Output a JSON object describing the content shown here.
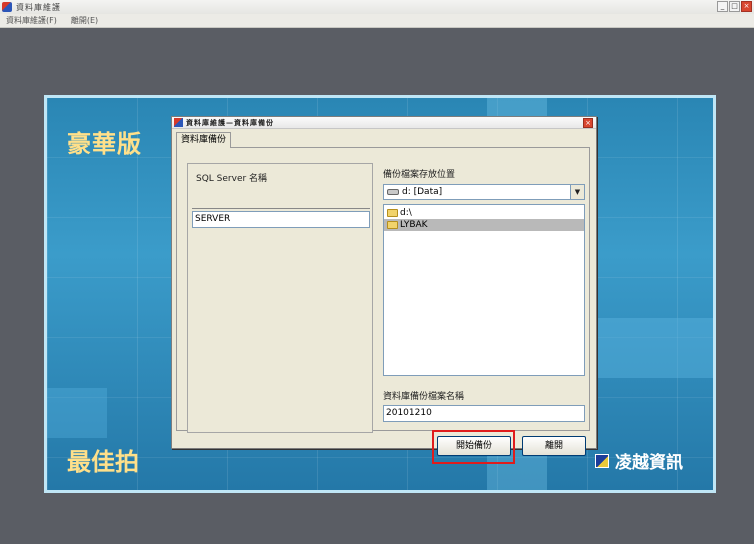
{
  "app": {
    "title": "資料庫維護",
    "menu": [
      "資料庫維護(F)",
      "離開(E)"
    ],
    "window_buttons": [
      "_",
      "□",
      "×"
    ]
  },
  "splash": {
    "title": "豪華版",
    "slogan": "最佳拍",
    "brand_name": "凌越資訊"
  },
  "dialog": {
    "title": "資料庫維護—資料庫備份",
    "close_symbol": "×",
    "tab": "資料庫備份",
    "server_label": "SQL Server 名稱",
    "server_value": "SERVER",
    "location_label": "備份檔案存放位置",
    "drive_value": "d: [Data]",
    "dropdown_symbol": "▼",
    "folders": [
      "d:\\",
      "LYBAK"
    ],
    "selected_folder": "LYBAK",
    "file_label": "資料庫備份檔案名稱",
    "file_value": "20101210",
    "start_button": "開始備份",
    "exit_button": "離開"
  },
  "colors": {
    "highlight": "#e01c1c",
    "splash_accent": "#ffe08a"
  }
}
